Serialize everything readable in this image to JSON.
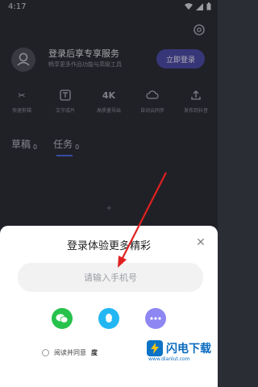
{
  "status": {
    "time": "4:17"
  },
  "header": {
    "login_title": "登录后享专享服务",
    "login_subtitle": "畅享更多作品功能与高级工具",
    "login_button": "立即登录"
  },
  "tools": [
    {
      "label": "快速剪辑",
      "icon": "scissors-icon"
    },
    {
      "label": "文字成片",
      "icon": "text-to-video-icon"
    },
    {
      "label": "高质量导出",
      "icon": "4k-icon",
      "icon_text": "4K"
    },
    {
      "label": "自动云同步",
      "icon": "cloud-sync-icon"
    },
    {
      "label": "发布到抖音",
      "icon": "upload-icon"
    }
  ],
  "tabs": [
    {
      "label": "草稿",
      "count": "0"
    },
    {
      "label": "任务",
      "count": "0"
    }
  ],
  "sheet": {
    "title": "登录体验更多精彩",
    "phone_placeholder": "请输入手机号",
    "agree_text": "阅读并同意",
    "agree_link": "度"
  },
  "watermark": {
    "brand": "闪电下载",
    "url": "www.dianlut.com"
  },
  "colors": {
    "accent": "#4a49a0",
    "wechat": "#27c24c",
    "qq": "#22b7f2",
    "more": "#8e86f2",
    "arrow": "#e02020"
  }
}
